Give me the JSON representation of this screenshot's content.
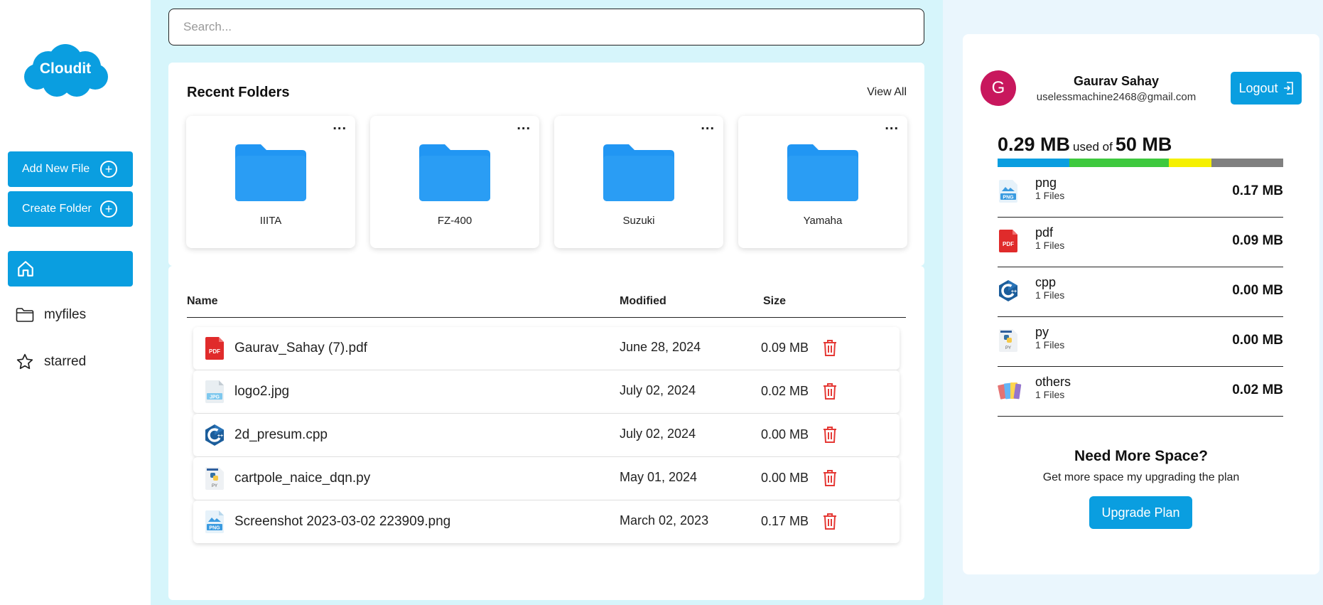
{
  "brand": {
    "name": "Cloudit"
  },
  "sidebar": {
    "add_file_label": "Add New File",
    "create_folder_label": "Create Folder",
    "nav": [
      {
        "label": "myfiles",
        "icon": "folder-icon"
      },
      {
        "label": "starred",
        "icon": "star-icon"
      }
    ]
  },
  "search": {
    "placeholder": "Search..."
  },
  "recent": {
    "title": "Recent Folders",
    "view_all": "View All",
    "more": "...",
    "folders": [
      "IIITA",
      "FZ-400",
      "Suzuki",
      "Yamaha"
    ]
  },
  "files": {
    "columns": {
      "name": "Name",
      "modified": "Modified",
      "size": "Size"
    },
    "rows": [
      {
        "name": "Gaurav_Sahay (7).pdf",
        "modified": "June 28, 2024",
        "size": "0.09 MB",
        "icon": "pdf-file-icon"
      },
      {
        "name": "logo2.jpg",
        "modified": "July 02, 2024",
        "size": "0.02 MB",
        "icon": "jpg-file-icon"
      },
      {
        "name": "2d_presum.cpp",
        "modified": "July 02, 2024",
        "size": "0.00 MB",
        "icon": "cpp-file-icon"
      },
      {
        "name": "cartpole_naice_dqn.py",
        "modified": "May 01, 2024",
        "size": "0.00 MB",
        "icon": "py-file-icon"
      },
      {
        "name": "Screenshot 2023-03-02 223909.png",
        "modified": "March 02, 2023",
        "size": "0.17 MB",
        "icon": "png-file-icon"
      }
    ]
  },
  "user": {
    "initial": "G",
    "name": "Gaurav Sahay",
    "email": "uselessmachine2468@gmail.com",
    "logout_label": "Logout",
    "avatar_color": "#c8175d"
  },
  "storage": {
    "used": "0.29 MB",
    "used_of": "used of",
    "total": "50 MB",
    "segments": [
      {
        "color": "#0a9ee0",
        "fraction": 0.25
      },
      {
        "color": "#3ec93e",
        "fraction": 0.35
      },
      {
        "color": "#f5f000",
        "fraction": 0.15
      },
      {
        "color": "#808080",
        "fraction": 0.25
      }
    ],
    "types": [
      {
        "name": "png",
        "count": "1 Files",
        "size": "0.17 MB",
        "icon": "png-type-icon"
      },
      {
        "name": "pdf",
        "count": "1 Files",
        "size": "0.09 MB",
        "icon": "pdf-type-icon"
      },
      {
        "name": "cpp",
        "count": "1 Files",
        "size": "0.00 MB",
        "icon": "cpp-type-icon"
      },
      {
        "name": "py",
        "count": "1 Files",
        "size": "0.00 MB",
        "icon": "py-type-icon"
      },
      {
        "name": "others",
        "count": "1 Files",
        "size": "0.02 MB",
        "icon": "others-type-icon"
      }
    ]
  },
  "upgrade": {
    "title": "Need More Space?",
    "subtitle": "Get more space my upgrading the plan",
    "button": "Upgrade Plan"
  },
  "colors": {
    "accent": "#0a9ee0",
    "main_bg": "#d6f5fb",
    "right_bg": "#eaf6fd",
    "delete": "#e53935"
  }
}
